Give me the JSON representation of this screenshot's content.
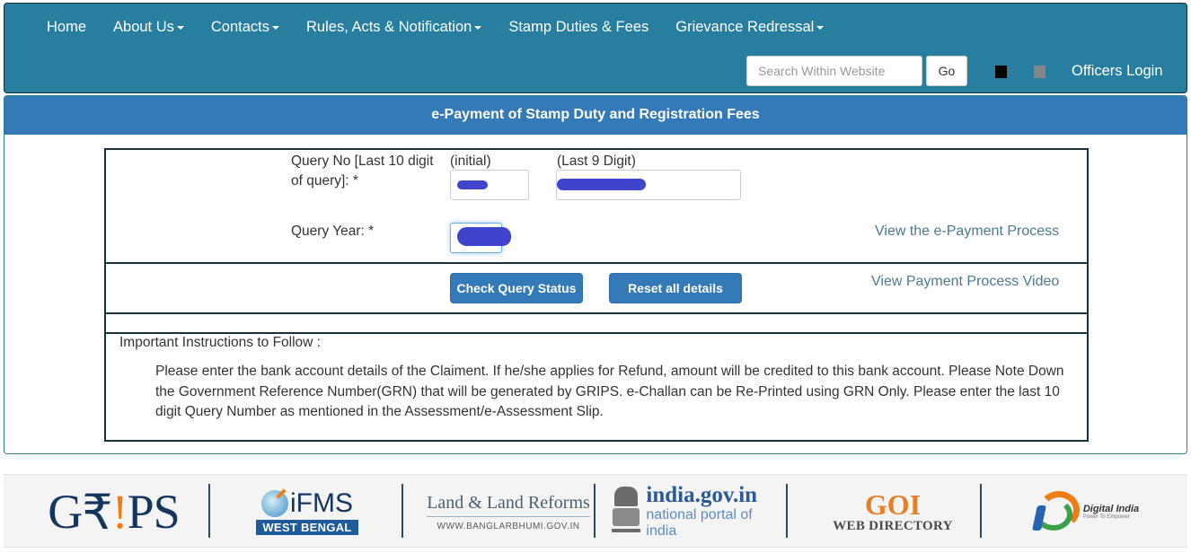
{
  "nav": {
    "items": [
      {
        "label": "Home",
        "has_dropdown": false
      },
      {
        "label": "About Us",
        "has_dropdown": true
      },
      {
        "label": "Contacts",
        "has_dropdown": true
      },
      {
        "label": "Rules, Acts & Notification",
        "has_dropdown": true
      },
      {
        "label": "Stamp Duties & Fees",
        "has_dropdown": false
      },
      {
        "label": "Grievance Redressal",
        "has_dropdown": true
      }
    ],
    "search": {
      "placeholder": "Search Within Website",
      "value": "",
      "go_label": "Go"
    },
    "contrast_options": [
      {
        "name": "black-theme",
        "color": "#050505"
      },
      {
        "name": "grey-theme",
        "color": "#858585"
      }
    ],
    "officers_login": "Officers Login"
  },
  "panel": {
    "title": "e-Payment of Stamp Duty and Registration Fees",
    "form": {
      "query_no_label": "Query No [Last 10 digit of query]: *",
      "initial_label": "(initial)",
      "last9_label": "(Last 9 Digit)",
      "initial_value": "[redacted]",
      "last9_value": "[redacted]",
      "query_year_label": "Query Year: *",
      "query_year_value": "[redacted]"
    },
    "links": {
      "epayment_process": "View the e-Payment Process",
      "payment_video": "View Payment Process Video"
    },
    "buttons": {
      "check_status": "Check Query Status",
      "reset": "Reset all details"
    },
    "instructions": {
      "title": "Important Instructions to Follow :",
      "body": "Please enter the bank account details of the Claiment. If he/she applies for Refund, amount will be credited to this bank account. Please Note Down the Government Reference Number(GRN) that will be generated by GRIPS. e-Challan can be Re-Printed using GRN Only. Please enter the last 10 digit Query Number as mentioned in the Assessment/e-Assessment Slip."
    }
  },
  "footer": {
    "logos": {
      "grips": {
        "pre": "G",
        "rupee": "₹",
        "bang": "!",
        "post": "PS"
      },
      "ifms": {
        "title": "iFMS",
        "subtitle": "WEST BENGAL"
      },
      "land": {
        "title": "Land & Land Reforms",
        "subtitle": "WWW.BANGLARBHUMI.GOV.IN"
      },
      "indiagov": {
        "title": "india.gov.in",
        "subtitle": "national portal of india"
      },
      "goi": {
        "title": "GOI",
        "subtitle": "WEB DIRECTORY"
      },
      "digital_india": {
        "title": "Digital India",
        "subtitle": "Power To Empower"
      }
    }
  },
  "colors": {
    "navbar": "#277e9e",
    "panel_heading": "#337ab7",
    "button": "#337ab7",
    "link": "#4a7a8c",
    "redaction": "#3e45cc",
    "accent_orange": "#ef7d14"
  }
}
